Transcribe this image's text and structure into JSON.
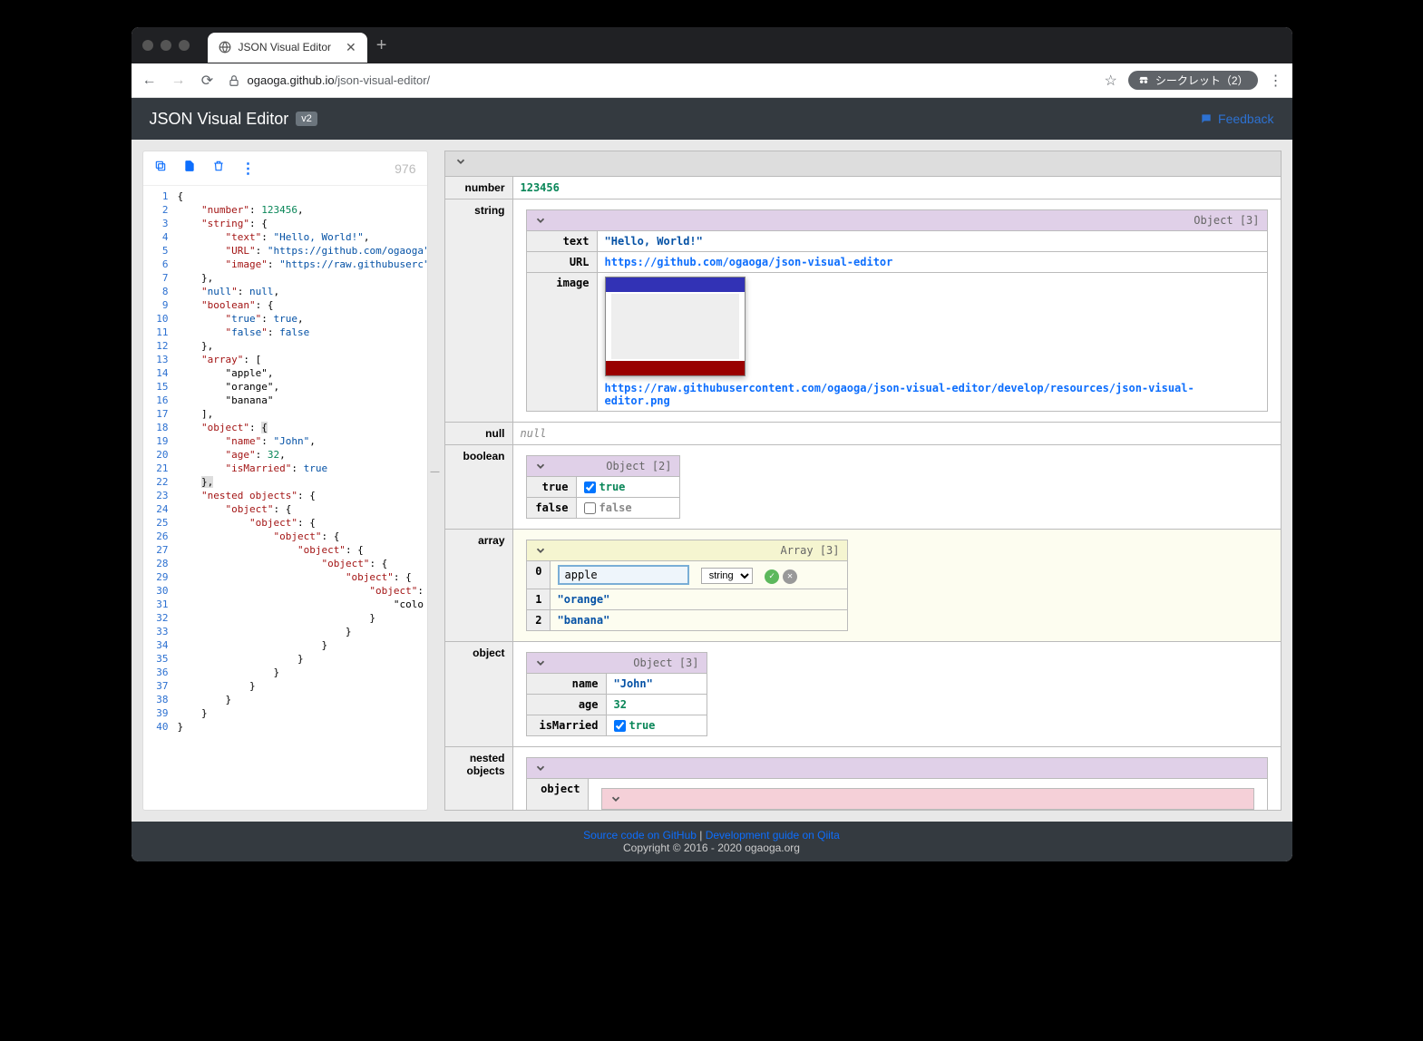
{
  "browser": {
    "tab_title": "JSON Visual Editor",
    "url_prefix": "ogaoga.github.io",
    "url_path": "/json-visual-editor/",
    "incognito_label": "シークレット（2）"
  },
  "header": {
    "title": "JSON Visual Editor",
    "version": "v2",
    "feedback": "Feedback"
  },
  "toolbar": {
    "char_count": "976"
  },
  "editor": {
    "lines": [
      "{",
      "    \"number\": 123456,",
      "    \"string\": {",
      "        \"text\": \"Hello, World!\",",
      "        \"URL\": \"https://github.com/ogaoga",
      "        \"image\": \"https://raw.githubuserc",
      "    },",
      "    \"null\": null,",
      "    \"boolean\": {",
      "        \"true\": true,",
      "        \"false\": false",
      "    },",
      "    \"array\": [",
      "        \"apple\",",
      "        \"orange\",",
      "        \"banana\"",
      "    ],",
      "    \"object\": {",
      "        \"name\": \"John\",",
      "        \"age\": 32,",
      "        \"isMarried\": true",
      "    },",
      "    \"nested objects\": {",
      "        \"object\": {",
      "            \"object\": {",
      "                \"object\": {",
      "                    \"object\": {",
      "                        \"object\": {",
      "                            \"object\": {",
      "                                \"object\":",
      "                                    \"colo",
      "                                }",
      "                            }",
      "                        }",
      "                    }",
      "                }",
      "            }",
      "        }",
      "    }",
      "}"
    ]
  },
  "viewer": {
    "number": {
      "key": "number",
      "value": "123456"
    },
    "string": {
      "key": "string",
      "meta": "Object [3]",
      "text_key": "text",
      "text_val": "\"Hello, World!\"",
      "url_key": "URL",
      "url_val": "https://github.com/ogaoga/json-visual-editor",
      "image_key": "image",
      "image_url": "https://raw.githubusercontent.com/ogaoga/json-visual-editor/develop/resources/json-visual-editor.png"
    },
    "null": {
      "key": "null",
      "value": "null"
    },
    "boolean": {
      "key": "boolean",
      "meta": "Object [2]",
      "true_key": "true",
      "true_val": "true",
      "false_key": "false",
      "false_val": "false"
    },
    "array": {
      "key": "array",
      "meta": "Array [3]",
      "i0": "0",
      "i1": "1",
      "i2": "2",
      "v0": "apple",
      "v1": "\"orange\"",
      "v2": "\"banana\"",
      "type_label": "string"
    },
    "object": {
      "key": "object",
      "meta": "Object [3]",
      "name_key": "name",
      "name_val": "\"John\"",
      "age_key": "age",
      "age_val": "32",
      "married_key": "isMarried",
      "married_val": "true"
    },
    "nested": {
      "key": "nested objects",
      "obj_key": "object"
    }
  },
  "footer": {
    "source_link": "Source code on GitHub",
    "guide_link": "Development guide on Qiita",
    "copyright": "Copyright © 2016 - 2020 ogaoga.org",
    "sep": " | "
  }
}
